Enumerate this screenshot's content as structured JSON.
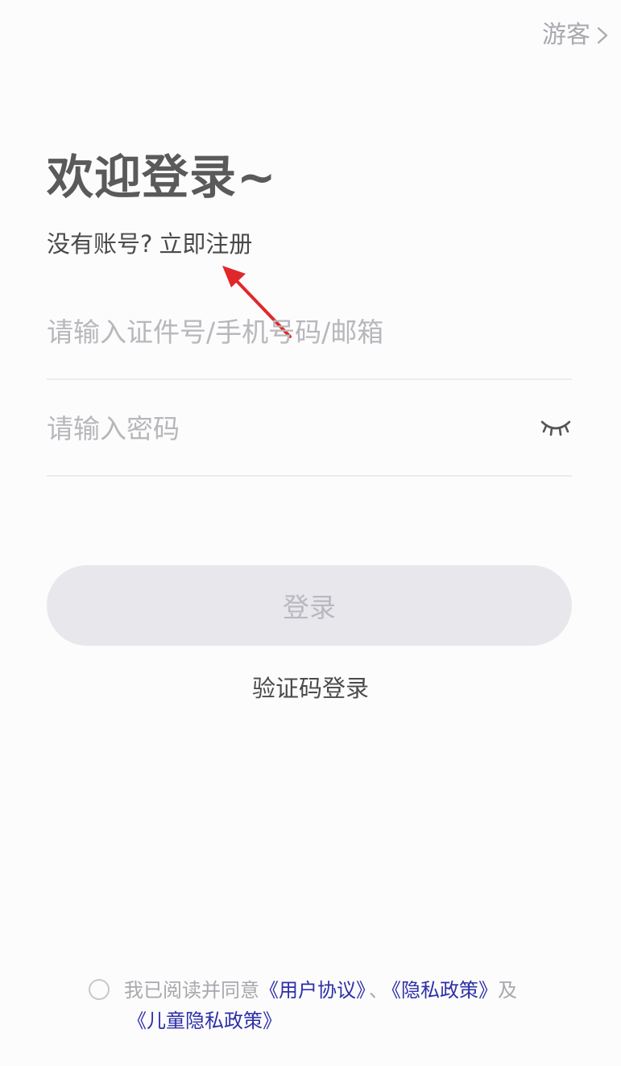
{
  "header": {
    "guest_label": "游客",
    "guest_icon": "chevron-right-icon"
  },
  "welcome": {
    "title": "欢迎登录~",
    "no_account_text": "没有账号?",
    "register_link": "立即注册"
  },
  "annotation": {
    "arrow_color": "#e0282a"
  },
  "form": {
    "account_placeholder": "请输入证件号/手机号码/邮箱",
    "account_value": "",
    "password_placeholder": "请输入密码",
    "password_value": "",
    "password_toggle_icon": "eye-closed-icon"
  },
  "actions": {
    "login_label": "登录",
    "code_login_label": "验证码登录"
  },
  "agreement": {
    "checked": false,
    "prefix": "我已阅读并同意",
    "user_agreement": "《用户协议》",
    "separator": "、",
    "privacy_policy": "《隐私政策》",
    "conjunction": "及",
    "child_privacy_policy": "《儿童隐私政策》"
  },
  "colors": {
    "background": "#fcfcfd",
    "link": "#2d2fa8",
    "button_bg": "#e8e8ec",
    "button_text": "#b8b8be",
    "placeholder": "#b7b7bc"
  }
}
